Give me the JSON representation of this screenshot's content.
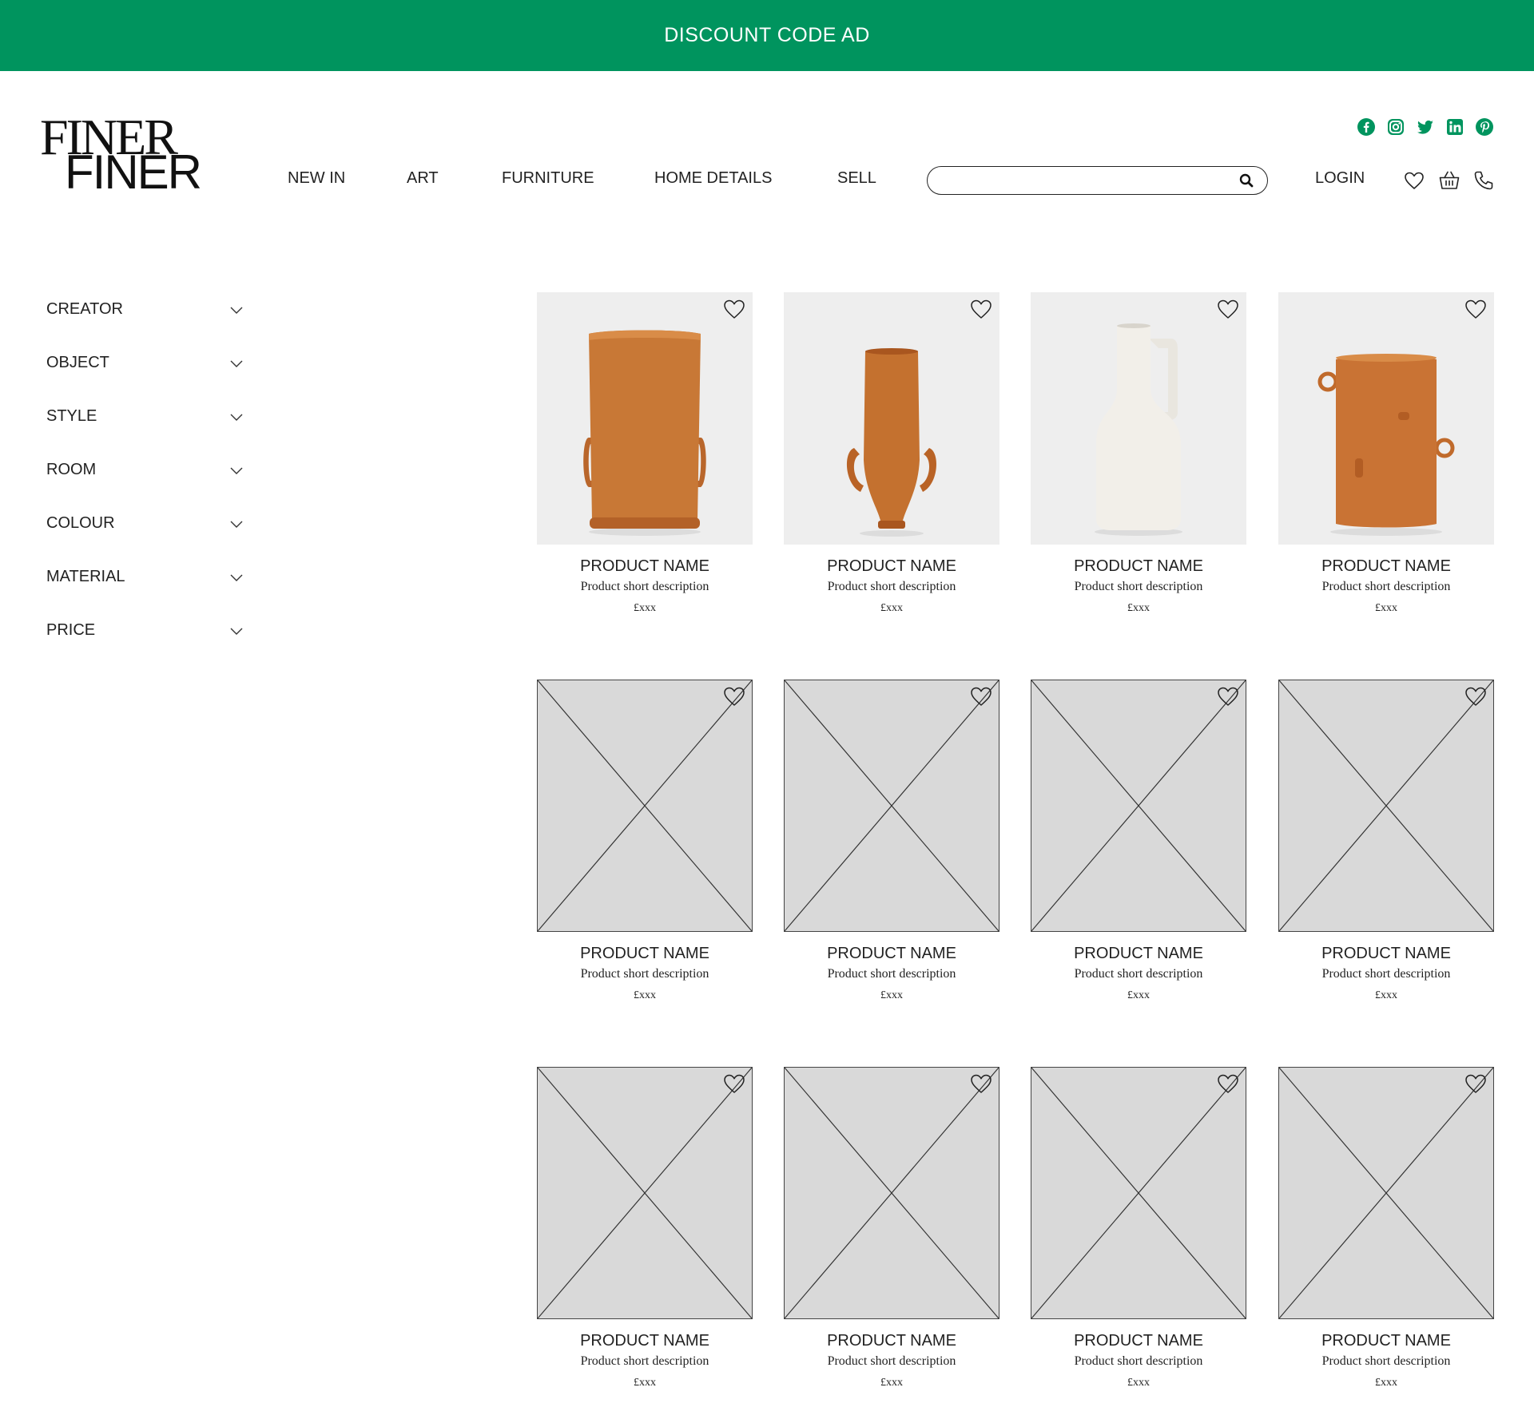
{
  "promo": {
    "text": "DISCOUNT CODE AD"
  },
  "brand": {
    "logo_line1": "FINER",
    "logo_line2": "FINER",
    "accent_color": "#00945e"
  },
  "social": [
    "facebook-icon",
    "instagram-icon",
    "twitter-icon",
    "linkedin-icon",
    "pinterest-icon"
  ],
  "nav": {
    "items": [
      {
        "label": "NEW IN"
      },
      {
        "label": "ART"
      },
      {
        "label": "FURNITURE"
      },
      {
        "label": "HOME DETAILS"
      },
      {
        "label": "SELL"
      }
    ]
  },
  "search": {
    "value": "",
    "placeholder": ""
  },
  "account": {
    "login_label": "LOGIN"
  },
  "header_icons": [
    "heart-icon",
    "basket-icon",
    "phone-icon"
  ],
  "filters": [
    {
      "label": "CREATOR"
    },
    {
      "label": "OBJECT"
    },
    {
      "label": "STYLE"
    },
    {
      "label": "ROOM"
    },
    {
      "label": "COLOUR"
    },
    {
      "label": "MATERIAL"
    },
    {
      "label": "PRICE"
    }
  ],
  "products": [
    {
      "name": "PRODUCT NAME",
      "description": "Product short description",
      "price": "£xxx",
      "image": "terracotta-vase-tall-handles"
    },
    {
      "name": "PRODUCT NAME",
      "description": "Product short description",
      "price": "£xxx",
      "image": "terracotta-vase-slim"
    },
    {
      "name": "PRODUCT NAME",
      "description": "Product short description",
      "price": "£xxx",
      "image": "white-jug"
    },
    {
      "name": "PRODUCT NAME",
      "description": "Product short description",
      "price": "£xxx",
      "image": "terracotta-vase-rings"
    },
    {
      "name": "PRODUCT NAME",
      "description": "Product short description",
      "price": "£xxx",
      "image": "placeholder"
    },
    {
      "name": "PRODUCT NAME",
      "description": "Product short description",
      "price": "£xxx",
      "image": "placeholder"
    },
    {
      "name": "PRODUCT NAME",
      "description": "Product short description",
      "price": "£xxx",
      "image": "placeholder"
    },
    {
      "name": "PRODUCT NAME",
      "description": "Product short description",
      "price": "£xxx",
      "image": "placeholder"
    },
    {
      "name": "PRODUCT NAME",
      "description": "Product short description",
      "price": "£xxx",
      "image": "placeholder"
    },
    {
      "name": "PRODUCT NAME",
      "description": "Product short description",
      "price": "£xxx",
      "image": "placeholder"
    },
    {
      "name": "PRODUCT NAME",
      "description": "Product short description",
      "price": "£xxx",
      "image": "placeholder"
    },
    {
      "name": "PRODUCT NAME",
      "description": "Product short description",
      "price": "£xxx",
      "image": "placeholder"
    }
  ]
}
